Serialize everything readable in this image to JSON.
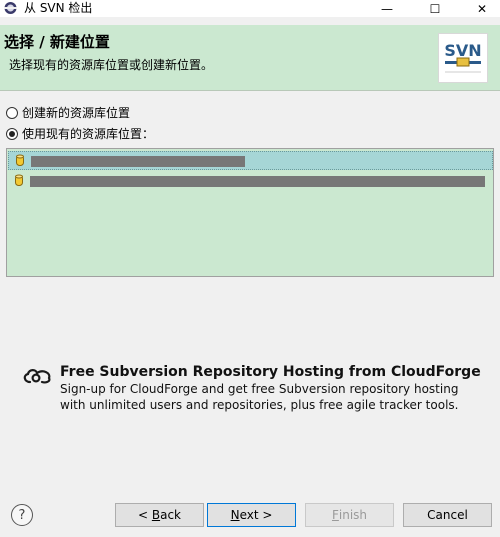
{
  "window": {
    "title": "从 SVN 检出",
    "minimize_glyph": "—",
    "maximize_glyph": "☐",
    "close_glyph": "✕"
  },
  "banner": {
    "title": "选择 / 新建位置",
    "description": "选择现有的资源库位置或创建新位置。",
    "logo_text": "SVN"
  },
  "options": {
    "create_new": "创建新的资源库位置",
    "use_existing": "使用现有的资源库位置：",
    "selected": "use_existing"
  },
  "repositories": [
    {
      "selected": true
    },
    {
      "selected": false
    }
  ],
  "cloudforge": {
    "title": "Free Subversion Repository Hosting from CloudForge",
    "line1": "Sign-up for CloudForge and get free Subversion repository hosting",
    "line2": "with unlimited users and repositories, plus free agile tracker tools."
  },
  "buttons": {
    "help": "?",
    "back_prefix": "< ",
    "back_mnemonic": "B",
    "back_rest": "ack",
    "next_mnemonic": "N",
    "next_rest": "ext >",
    "finish_mnemonic": "F",
    "finish_rest": "inish",
    "cancel": "Cancel"
  },
  "colors": {
    "banner_bg": "#cbe8d0",
    "list_bg": "#cbe8d0",
    "selection_bg": "#a6d6d6",
    "default_button_border": "#0078d7"
  }
}
